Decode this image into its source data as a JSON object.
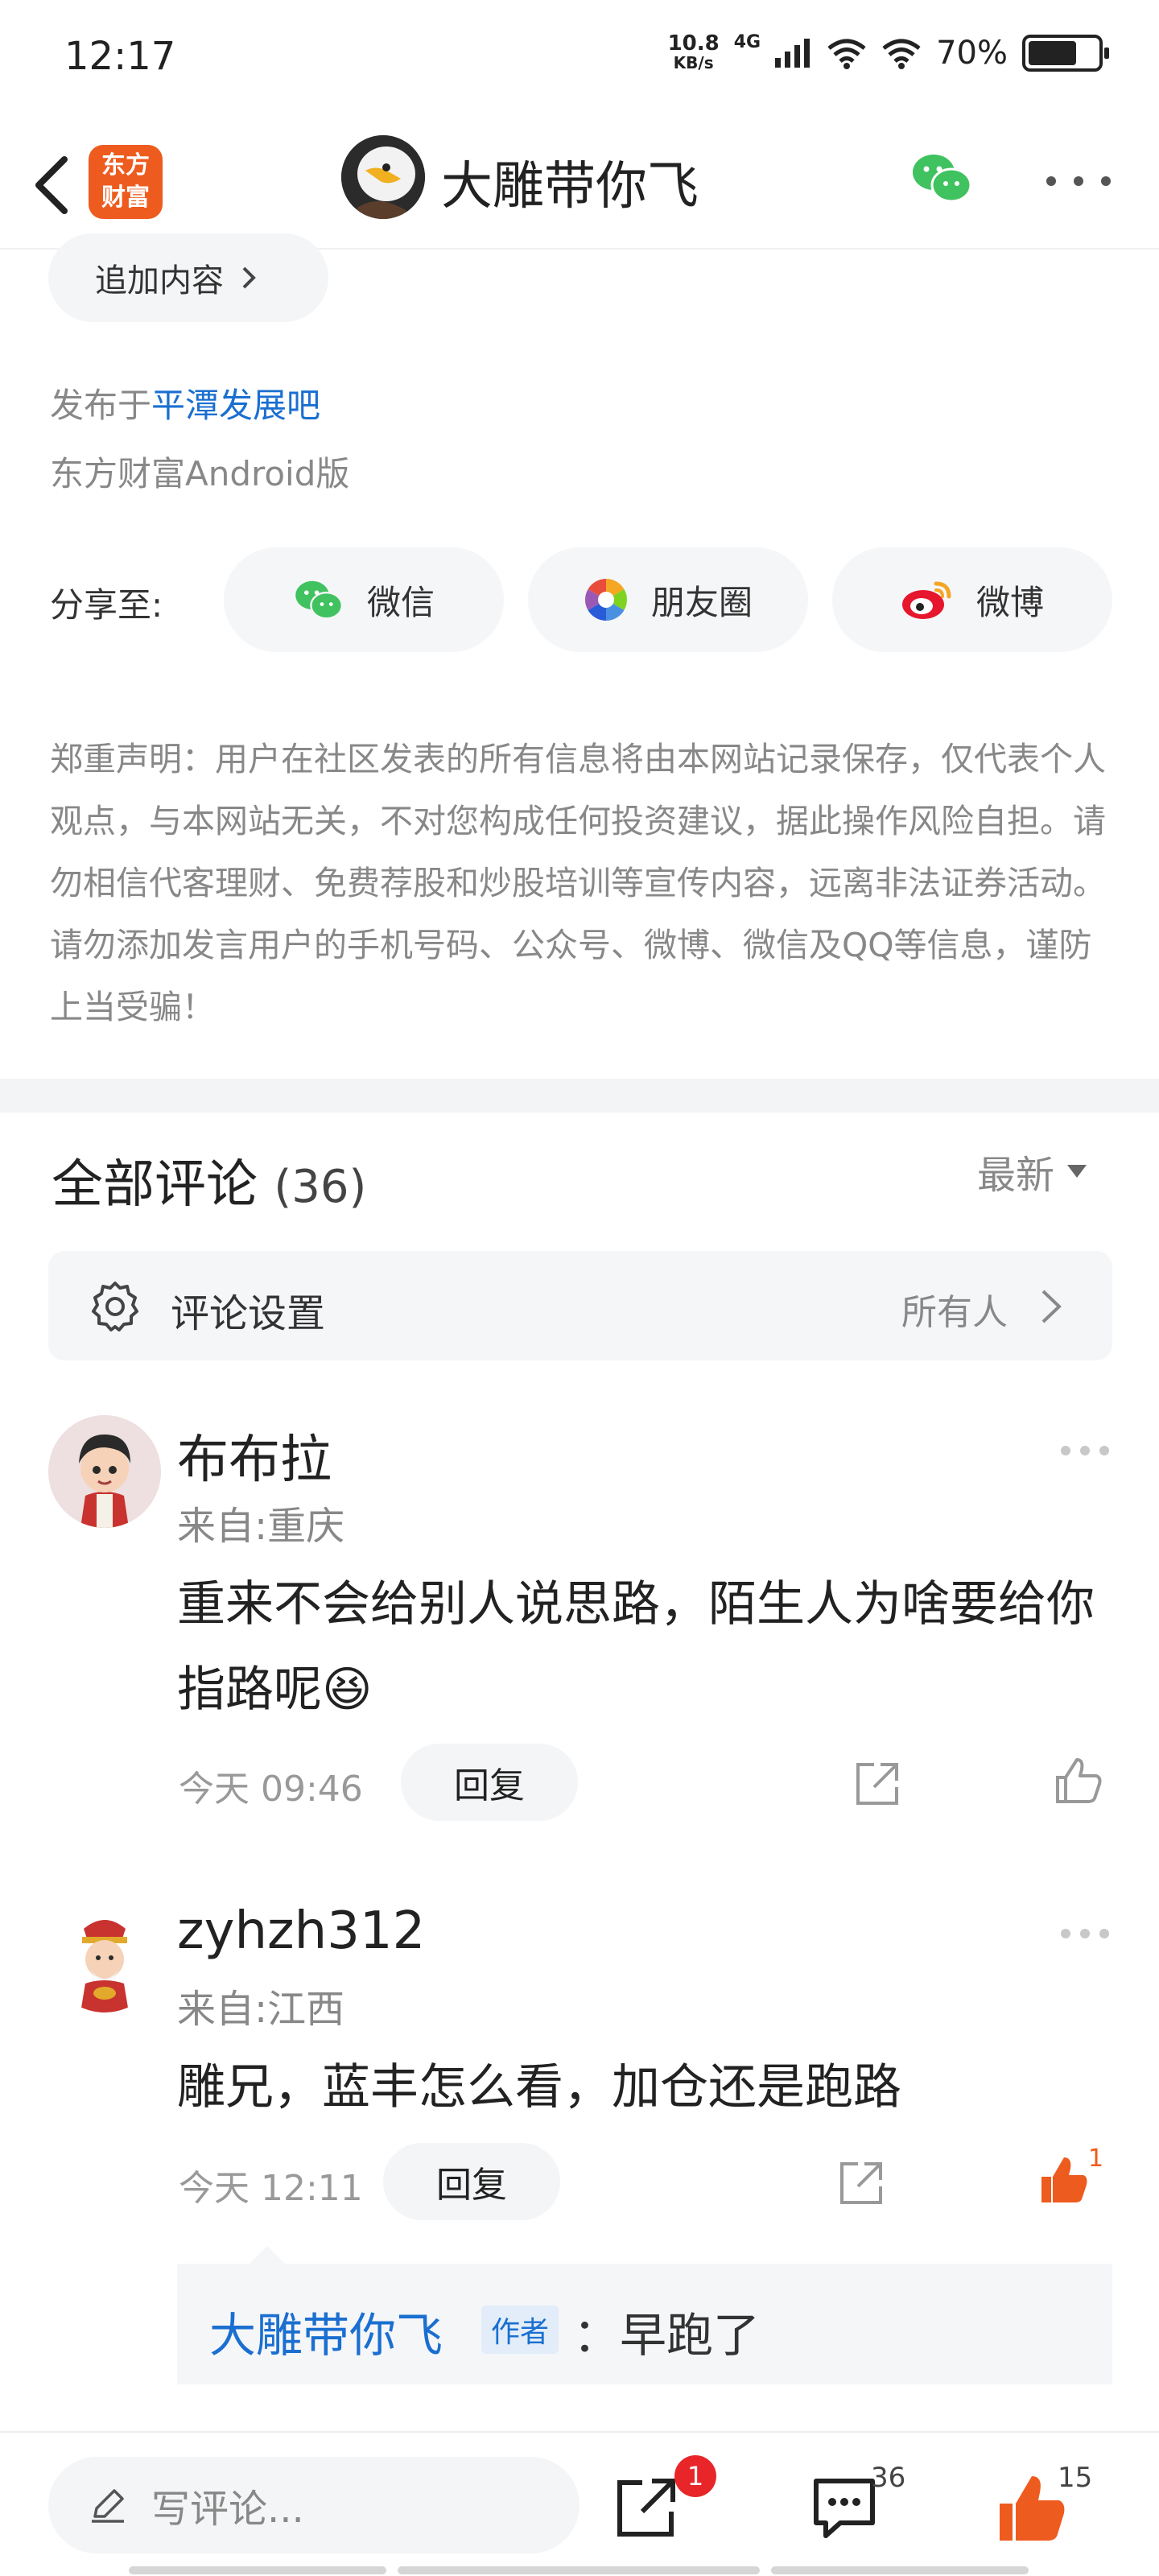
{
  "status_bar": {
    "time": "12:17",
    "net_speed_value": "10.8",
    "net_speed_unit": "KB/s",
    "network_type": "4G",
    "battery": "70%",
    "battery_level": 0.7
  },
  "header": {
    "app_logo_line1": "东方",
    "app_logo_line2": "财富",
    "title": "大雕带你飞",
    "icons": [
      "back-arrow-icon",
      "wechat-icon",
      "more-icon"
    ]
  },
  "post": {
    "add_content_label": "追加内容",
    "posted_prefix": "发布于",
    "forum_link": "平潭发展吧",
    "platform": "东方财富Android版",
    "share_label": "分享至:",
    "share_targets": [
      {
        "label": "微信",
        "icon": "wechat-icon"
      },
      {
        "label": "朋友圈",
        "icon": "moments-icon"
      },
      {
        "label": "微博",
        "icon": "weibo-icon"
      }
    ],
    "disclaimer": "郑重声明：用户在社区发表的所有信息将由本网站记录保存，仅代表个人观点，与本网站无关，不对您构成任何投资建议，据此操作风险自担。请勿相信代客理财、免费荐股和炒股培训等宣传内容，远离非法证券活动。请勿添加发言用户的手机号码、公众号、微博、微信及QQ等信息，谨防上当受骗！"
  },
  "comments_section": {
    "title": "全部评论",
    "count": "(36)",
    "sort_label": "最新",
    "settings_label": "评论设置",
    "settings_value": "所有人"
  },
  "comments": [
    {
      "user": "布布拉",
      "location": "来自:重庆",
      "text": "重来不会给别人说思路，陌生人为啥要给你指路呢😆",
      "time": "今天 09:46",
      "reply_label": "回复",
      "likes": ""
    },
    {
      "user": "zyhzh312",
      "location": "来自:江西",
      "text": "雕兄，蓝丰怎么看，加仓还是跑路",
      "time": "今天 12:11",
      "reply_label": "回复",
      "likes": "1"
    }
  ],
  "author_reply": {
    "author": "大雕带你飞",
    "badge": "作者",
    "text": "：早跑了"
  },
  "bottom_bar": {
    "placeholder": "写评论...",
    "share_badge": "1",
    "comment_count": "36",
    "like_count": "15"
  },
  "colors": {
    "brand_orange": "#ee5b1e",
    "link_blue": "#1a6fd0",
    "badge_red": "#e8262a"
  }
}
